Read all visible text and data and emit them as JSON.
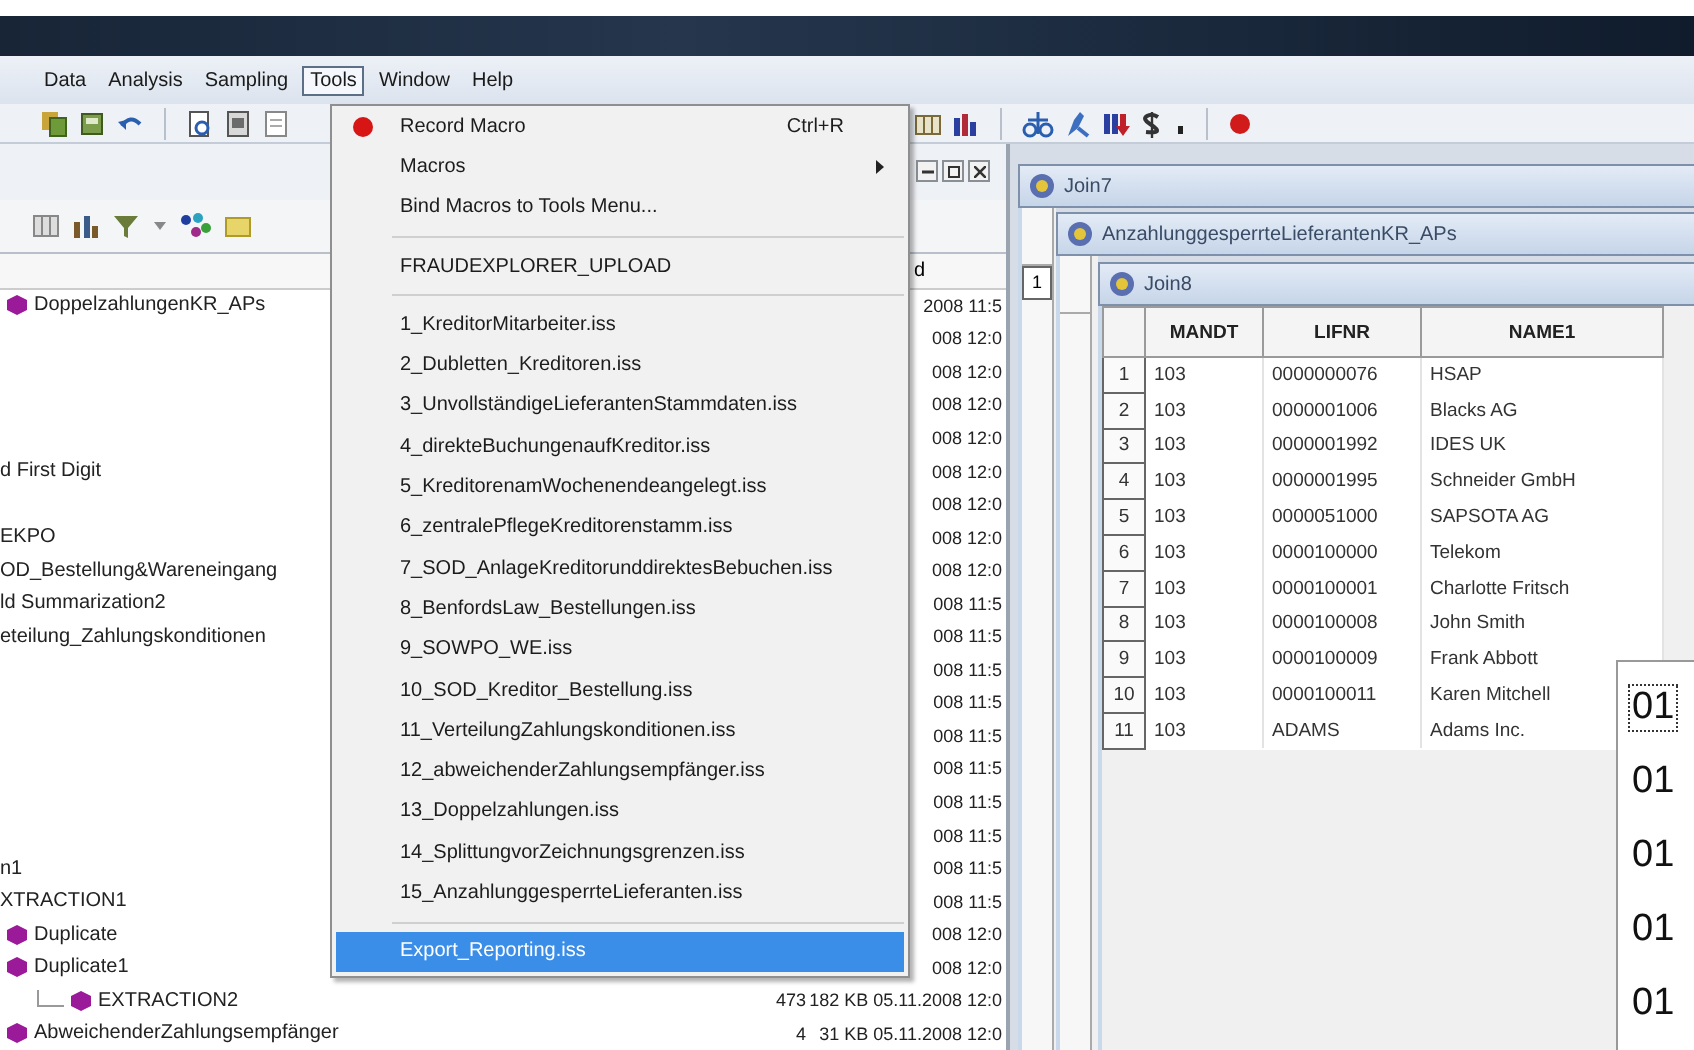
{
  "menubar": [
    {
      "label": "Data",
      "selected": false
    },
    {
      "label": "Analysis",
      "selected": false
    },
    {
      "label": "Sampling",
      "selected": false
    },
    {
      "label": "Tools",
      "selected": true
    },
    {
      "label": "Window",
      "selected": false
    },
    {
      "label": "Help",
      "selected": false
    }
  ],
  "explorer": {
    "header": "d",
    "rows": [
      {
        "kind": "database",
        "name": "DoppelzahlungenKR_APs",
        "tail": "2008 11:5"
      },
      {
        "kind": "text",
        "tail": "008 12:0"
      },
      {
        "kind": "text",
        "tail": "008 12:0"
      },
      {
        "kind": "text",
        "tail": "008 12:0"
      },
      {
        "kind": "text",
        "tail": "008 12:0"
      },
      {
        "kind": "text",
        "name": "d First Digit",
        "tail": "008 12:0"
      },
      {
        "kind": "text",
        "tail": "008 12:0"
      },
      {
        "kind": "text",
        "name": "EKPO",
        "tail": "008 12:0"
      },
      {
        "kind": "text",
        "name": "OD_Bestellung&Wareneingang",
        "tail": "008 12:0"
      },
      {
        "kind": "text",
        "name": "ld Summarization2",
        "tail": "008 11:5"
      },
      {
        "kind": "text",
        "name": "eteilung_Zahlungskonditionen",
        "tail": "008 11:5"
      },
      {
        "kind": "text",
        "tail": "008 11:5"
      },
      {
        "kind": "text",
        "tail": "008 11:5"
      },
      {
        "kind": "text",
        "tail": "008 11:5"
      },
      {
        "kind": "text",
        "tail": "008 11:5"
      },
      {
        "kind": "text",
        "tail": "008 11:5"
      },
      {
        "kind": "text",
        "tail": "008 11:5"
      },
      {
        "kind": "text",
        "name": "n1",
        "tail": "008 11:5"
      },
      {
        "kind": "text",
        "name": "XTRACTION1",
        "tail": "008 11:5"
      },
      {
        "kind": "database",
        "name": "Duplicate",
        "tail": "008 12:0"
      },
      {
        "kind": "database",
        "name": "Duplicate1",
        "tail": "008 12:0",
        "children": [
          {
            "kind": "database",
            "name": "EXTRACTION2",
            "records": "473",
            "info": "182 KB 05.11.2008 12:0"
          }
        ]
      },
      {
        "kind": "database",
        "name": "AbweichenderZahlungsempfänger",
        "records": "4",
        "info": "31 KB 05.11.2008 12:0"
      }
    ]
  },
  "tools_menu": [
    {
      "kind": "record",
      "label": "Record Macro",
      "shortcut": "Ctrl+R",
      "selected": false
    },
    {
      "kind": "submenu",
      "label": "Macros",
      "selected": false
    },
    {
      "kind": "command",
      "label": "Bind Macros to Tools Menu...",
      "selected": false
    },
    {
      "kind": "separator"
    },
    {
      "kind": "command",
      "label": "FRAUDEXPLORER_UPLOAD",
      "selected": false
    },
    {
      "kind": "separator"
    },
    {
      "kind": "command",
      "label": "1_KreditorMitarbeiter.iss",
      "selected": false
    },
    {
      "kind": "command",
      "label": "2_Dubletten_Kreditoren.iss",
      "selected": false
    },
    {
      "kind": "command",
      "label": "3_UnvollständigeLieferantenStammdaten.iss",
      "selected": false
    },
    {
      "kind": "command",
      "label": "4_direkteBuchungenaufKreditor.iss",
      "selected": false
    },
    {
      "kind": "command",
      "label": "5_KreditorenamWochenendeangelegt.iss",
      "selected": false
    },
    {
      "kind": "command",
      "label": "6_zentralePflegeKreditorenstamm.iss",
      "selected": false
    },
    {
      "kind": "command",
      "label": "7_SOD_AnlageKreditorunddirektesBebuchen.iss",
      "selected": false
    },
    {
      "kind": "command",
      "label": "8_BenfordsLaw_Bestellungen.iss",
      "selected": false
    },
    {
      "kind": "command",
      "label": "9_SOWPO_WE.iss",
      "selected": false
    },
    {
      "kind": "command",
      "label": "10_SOD_Kreditor_Bestellung.iss",
      "selected": false
    },
    {
      "kind": "command",
      "label": "11_VerteilungZahlungskonditionen.iss",
      "selected": false
    },
    {
      "kind": "command",
      "label": "12_abweichenderZahlungsempfänger.iss",
      "selected": false
    },
    {
      "kind": "command",
      "label": "13_Doppelzahlungen.iss",
      "selected": false
    },
    {
      "kind": "command",
      "label": "14_SplittungvorZeichnungsgrenzen.iss",
      "selected": false
    },
    {
      "kind": "command",
      "label": "15_AnzahlunggesperrteLieferanten.iss",
      "selected": false
    },
    {
      "kind": "separator"
    },
    {
      "kind": "command",
      "label": "Export_Reporting.iss",
      "selected": true
    }
  ],
  "windows": [
    {
      "title": "Join7",
      "row_numbers": [
        "1"
      ]
    },
    {
      "title": "AnzahlunggesperrteLieferantenKR_APs"
    },
    {
      "title": "Join8",
      "columns": [
        "MANDT",
        "LIFNR",
        "NAME1"
      ],
      "rows": [
        {
          "number": "1",
          "cells": [
            "103",
            "0000000076",
            "HSAP"
          ]
        },
        {
          "number": "2",
          "cells": [
            "103",
            "0000001006",
            "Blacks AG"
          ]
        },
        {
          "number": "3",
          "cells": [
            "103",
            "0000001992",
            "IDES UK"
          ]
        },
        {
          "number": "4",
          "cells": [
            "103",
            "0000001995",
            "Schneider GmbH"
          ]
        },
        {
          "number": "5",
          "cells": [
            "103",
            "0000051000",
            "SAPSOTA AG"
          ]
        },
        {
          "number": "6",
          "cells": [
            "103",
            "0000100000",
            "Telekom"
          ]
        },
        {
          "number": "7",
          "cells": [
            "103",
            "0000100001",
            "Charlotte Fritsch"
          ]
        },
        {
          "number": "8",
          "cells": [
            "103",
            "0000100008",
            "John Smith"
          ]
        },
        {
          "number": "9",
          "cells": [
            "103",
            "0000100009",
            "Frank Abbott"
          ]
        },
        {
          "number": "10",
          "cells": [
            "103",
            "0000100011",
            "Karen Mitchell"
          ]
        },
        {
          "number": "11",
          "cells": [
            "103",
            "ADAMS",
            "Adams Inc."
          ]
        }
      ]
    }
  ],
  "popup": {
    "items": [
      {
        "text": "01",
        "focused": true
      },
      {
        "text": "01",
        "focused": false
      },
      {
        "text": "01",
        "focused": false
      },
      {
        "text": "01",
        "focused": false
      },
      {
        "text": "01",
        "focused": false
      }
    ]
  }
}
